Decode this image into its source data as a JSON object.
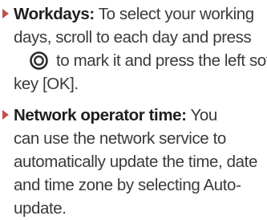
{
  "items": [
    {
      "label": "Workdays:",
      "line1_rest": " To select your working",
      "line2": "days, scroll to each day and press",
      "icon": "center-select-key-icon",
      "line3_rest": "to mark it and press the left soft",
      "line4": "key [OK]."
    },
    {
      "label": "Network operator time:",
      "line1_rest": " You",
      "line2": "can use the network service to",
      "line3": "automatically update the time, date",
      "line4": "and time zone by selecting Auto-",
      "line5": "update."
    }
  ],
  "colors": {
    "bullet": "#c0504d",
    "text": "#3a3a3a",
    "label": "#1f1f1f"
  }
}
